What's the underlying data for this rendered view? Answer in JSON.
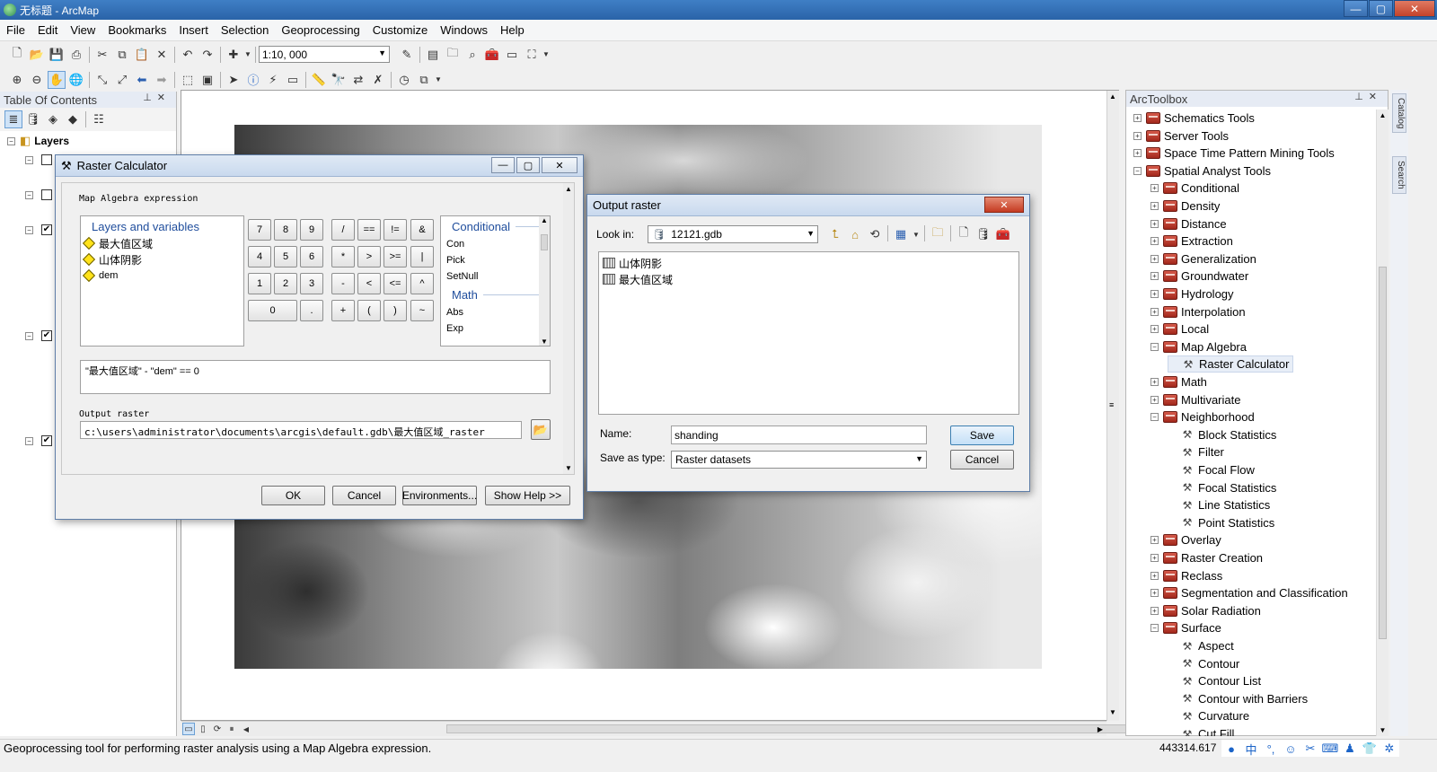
{
  "window": {
    "title": "无标题 - ArcMap",
    "minimize": "—",
    "maximize": "▢",
    "close": "✕"
  },
  "menu": [
    "File",
    "Edit",
    "View",
    "Bookmarks",
    "Insert",
    "Selection",
    "Geoprocessing",
    "Customize",
    "Windows",
    "Help"
  ],
  "toolbar": {
    "scale": "1:10, 000"
  },
  "toc": {
    "title": "Table Of Contents",
    "layers_label": "Layers",
    "rows": [
      {
        "expander": "⊟",
        "checked": ""
      },
      {
        "expander": "⊟",
        "checked": ""
      },
      {
        "expander": "⊟",
        "checked": "✔"
      },
      {
        "expander": "⊟",
        "checked": "✔"
      },
      {
        "expander": "⊟",
        "checked": "✔"
      }
    ]
  },
  "raster_calculator": {
    "title": "Raster Calculator",
    "section_label": "Map Algebra expression",
    "layers_header": "Layers and variables",
    "layers": [
      "最大值区域",
      "山体阴影",
      "dem"
    ],
    "keypad": [
      "7",
      "8",
      "9",
      "/",
      "==",
      "!=",
      "&",
      "4",
      "5",
      "6",
      "*",
      ">",
      ">=",
      "|",
      "1",
      "2",
      "3",
      "-",
      "<",
      "<=",
      "^",
      "0",
      ".",
      "+",
      "(",
      ")",
      "~"
    ],
    "functions": {
      "group1": "Conditional",
      "group1_items": [
        "Con",
        "Pick",
        "SetNull"
      ],
      "group2": "Math",
      "group2_items": [
        "Abs",
        "Exp"
      ]
    },
    "expression": "\"最大值区域\" - \"dem\" == 0",
    "output_label": "Output raster",
    "output_value": "c:\\users\\administrator\\documents\\arcgis\\default.gdb\\最大值区域_raster",
    "buttons": {
      "ok": "OK",
      "cancel": "Cancel",
      "environments": "Environments...",
      "help": "Show Help >>"
    }
  },
  "output_dialog": {
    "title": "Output raster",
    "look_in_label": "Look in:",
    "look_in_value": "12121.gdb",
    "items": [
      "山体阴影",
      "最大值区域"
    ],
    "name_label": "Name:",
    "name_value": "shanding",
    "type_label": "Save as type:",
    "type_value": "Raster datasets",
    "save": "Save",
    "cancel": "Cancel"
  },
  "arctoolbox": {
    "title": "ArcToolbox",
    "items": [
      {
        "label": "Schematics Tools",
        "kind": "toolbox",
        "level": 0,
        "exp": "⊞"
      },
      {
        "label": "Server Tools",
        "kind": "toolbox",
        "level": 0,
        "exp": "⊞"
      },
      {
        "label": "Space Time Pattern Mining Tools",
        "kind": "toolbox",
        "level": 0,
        "exp": "⊞"
      },
      {
        "label": "Spatial Analyst Tools",
        "kind": "toolbox",
        "level": 0,
        "exp": "⊟"
      },
      {
        "label": "Conditional",
        "kind": "toolset",
        "level": 1,
        "exp": "⊞"
      },
      {
        "label": "Density",
        "kind": "toolset",
        "level": 1,
        "exp": "⊞"
      },
      {
        "label": "Distance",
        "kind": "toolset",
        "level": 1,
        "exp": "⊞"
      },
      {
        "label": "Extraction",
        "kind": "toolset",
        "level": 1,
        "exp": "⊞"
      },
      {
        "label": "Generalization",
        "kind": "toolset",
        "level": 1,
        "exp": "⊞"
      },
      {
        "label": "Groundwater",
        "kind": "toolset",
        "level": 1,
        "exp": "⊞"
      },
      {
        "label": "Hydrology",
        "kind": "toolset",
        "level": 1,
        "exp": "⊞"
      },
      {
        "label": "Interpolation",
        "kind": "toolset",
        "level": 1,
        "exp": "⊞"
      },
      {
        "label": "Local",
        "kind": "toolset",
        "level": 1,
        "exp": "⊞"
      },
      {
        "label": "Map Algebra",
        "kind": "toolset",
        "level": 1,
        "exp": "⊟"
      },
      {
        "label": "Raster Calculator",
        "kind": "tool",
        "level": 2,
        "exp": ""
      },
      {
        "label": "Math",
        "kind": "toolset",
        "level": 1,
        "exp": "⊞"
      },
      {
        "label": "Multivariate",
        "kind": "toolset",
        "level": 1,
        "exp": "⊞"
      },
      {
        "label": "Neighborhood",
        "kind": "toolset",
        "level": 1,
        "exp": "⊟"
      },
      {
        "label": "Block Statistics",
        "kind": "tool",
        "level": 2,
        "exp": ""
      },
      {
        "label": "Filter",
        "kind": "tool",
        "level": 2,
        "exp": ""
      },
      {
        "label": "Focal Flow",
        "kind": "tool",
        "level": 2,
        "exp": ""
      },
      {
        "label": "Focal Statistics",
        "kind": "tool",
        "level": 2,
        "exp": ""
      },
      {
        "label": "Line Statistics",
        "kind": "tool",
        "level": 2,
        "exp": ""
      },
      {
        "label": "Point Statistics",
        "kind": "tool",
        "level": 2,
        "exp": ""
      },
      {
        "label": "Overlay",
        "kind": "toolset",
        "level": 1,
        "exp": "⊞"
      },
      {
        "label": "Raster Creation",
        "kind": "toolset",
        "level": 1,
        "exp": "⊞"
      },
      {
        "label": "Reclass",
        "kind": "toolset",
        "level": 1,
        "exp": "⊞"
      },
      {
        "label": "Segmentation and Classification",
        "kind": "toolset",
        "level": 1,
        "exp": "⊞"
      },
      {
        "label": "Solar Radiation",
        "kind": "toolset",
        "level": 1,
        "exp": "⊞"
      },
      {
        "label": "Surface",
        "kind": "toolset",
        "level": 1,
        "exp": "⊟"
      },
      {
        "label": "Aspect",
        "kind": "tool",
        "level": 2,
        "exp": ""
      },
      {
        "label": "Contour",
        "kind": "tool",
        "level": 2,
        "exp": ""
      },
      {
        "label": "Contour List",
        "kind": "tool",
        "level": 2,
        "exp": ""
      },
      {
        "label": "Contour with Barriers",
        "kind": "tool",
        "level": 2,
        "exp": ""
      },
      {
        "label": "Curvature",
        "kind": "tool",
        "level": 2,
        "exp": ""
      },
      {
        "label": "Cut Fill",
        "kind": "tool",
        "level": 2,
        "exp": ""
      }
    ]
  },
  "side_tabs": [
    "Catalog",
    "Search"
  ],
  "status": {
    "message": "Geoprocessing tool for performing raster analysis using a Map Algebra expression.",
    "coords": "443314.617"
  },
  "colors": {
    "title_bar": "#2a63a8",
    "link_blue": "#1f4d9c"
  }
}
